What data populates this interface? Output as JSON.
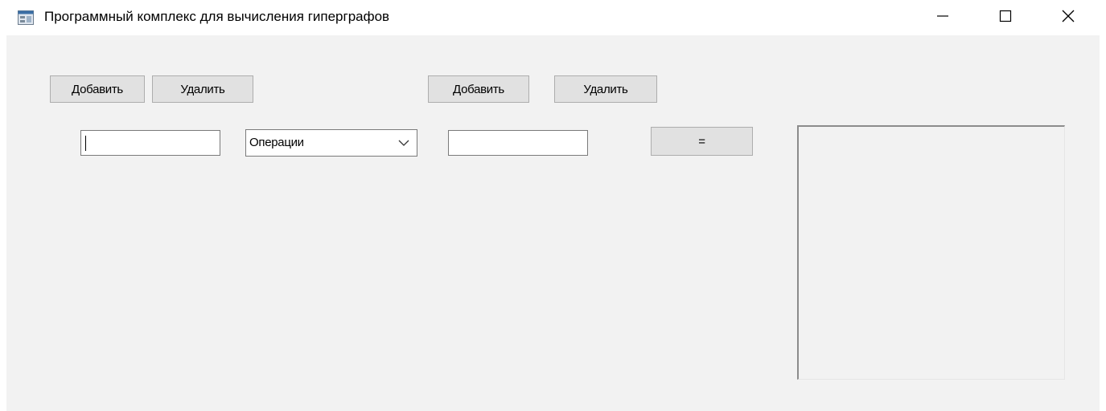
{
  "window": {
    "title": "Программный комплекс для вычисления гиперграфов",
    "icons": {
      "app": "app-icon",
      "minimize": "minimize-icon",
      "maximize": "maximize-icon",
      "close": "close-icon"
    }
  },
  "left_group": {
    "add_label": "Добавить",
    "remove_label": "Удалить",
    "input_value": ""
  },
  "operations": {
    "selected": "Операции",
    "icon": "chevron-down-icon"
  },
  "right_group": {
    "add_label": "Добавить",
    "remove_label": "Удалить",
    "input_value": ""
  },
  "equals_label": "=",
  "colors": {
    "client_bg": "#f2f2f2",
    "button_bg": "#e1e1e1",
    "button_border": "#adadad",
    "input_border": "#7a7a7a"
  }
}
